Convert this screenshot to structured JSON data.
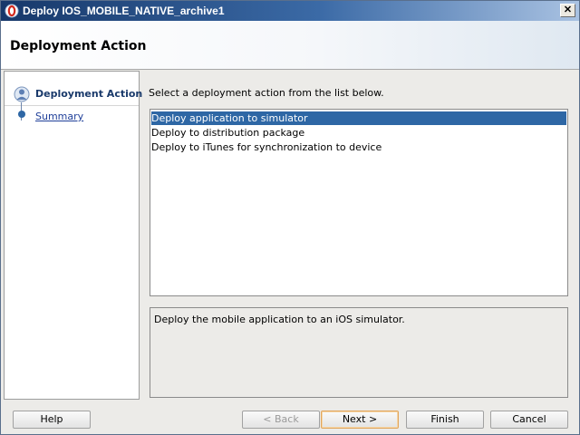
{
  "window": {
    "title": "Deploy IOS_MOBILE_NATIVE_archive1",
    "close_glyph": "✕"
  },
  "header": {
    "title": "Deployment Action"
  },
  "steps": [
    {
      "label": "Deployment Action",
      "state": "active"
    },
    {
      "label": "Summary",
      "state": "link"
    }
  ],
  "main": {
    "instruction": "Select a deployment action from the list below.",
    "actions": [
      {
        "label": "Deploy application to simulator",
        "selected": true
      },
      {
        "label": "Deploy to distribution package",
        "selected": false
      },
      {
        "label": "Deploy to iTunes for synchronization to device",
        "selected": false
      }
    ],
    "description": "Deploy the mobile application to an iOS simulator."
  },
  "footer": {
    "help": "Help",
    "back": "< Back",
    "next": "Next >",
    "finish": "Finish",
    "cancel": "Cancel"
  },
  "colors": {
    "title_bar": "#3b6aa6",
    "selection": "#2e67a5",
    "default_button_border": "#e1a55c"
  }
}
